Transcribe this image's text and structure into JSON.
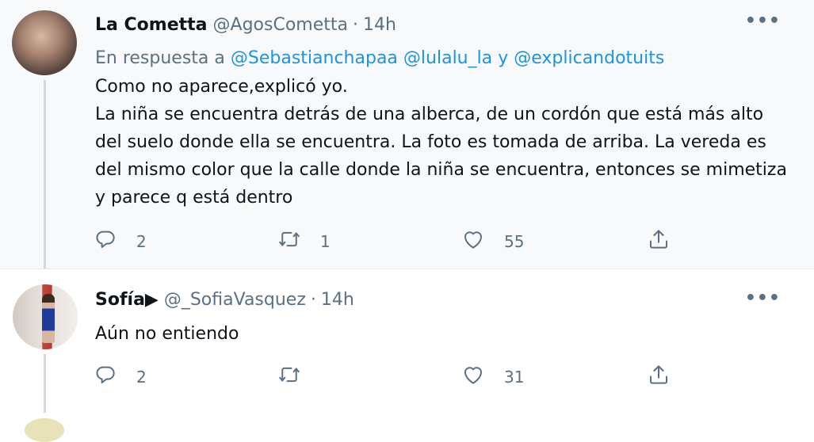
{
  "tweets": [
    {
      "name": "La Cometta",
      "handle": "@AgosCometta",
      "dot": "·",
      "time": "14h",
      "reply_prefix": "En respuesta a ",
      "mentions": [
        "@Sebastianchapaa",
        "@lulalu_la",
        "@explicandotuits"
      ],
      "mention_sep": " ",
      "mention_and": " y ",
      "text_lines": [
        "Como no aparece,explicó yo.",
        "La niña se encuentra detrás de una alberca, de un cordón que está más alto del suelo donde ella se encuentra. La foto es tomada de arriba. La vereda es del mismo color que la calle donde la niña se encuentra, entonces se mimetiza y parece q está dentro"
      ],
      "replies": "2",
      "retweets": "1",
      "likes": "55",
      "more": "•••"
    },
    {
      "name": "Sofía▶",
      "handle": "@_SofiaVasquez",
      "dot": "·",
      "time": "14h",
      "text_lines": [
        "Aún no entiendo"
      ],
      "replies": "2",
      "retweets": "",
      "likes": "31",
      "more": "•••"
    }
  ],
  "icons": {
    "reply": "reply-icon",
    "retweet": "retweet-icon",
    "like": "heart-icon",
    "share": "share-icon",
    "more": "more-icon"
  },
  "colors": {
    "text": "#0f1419",
    "muted": "#5b7083",
    "link": "#1b95e0",
    "thread": "#cfd9de",
    "highlight_bg": "#f7f9fa"
  }
}
